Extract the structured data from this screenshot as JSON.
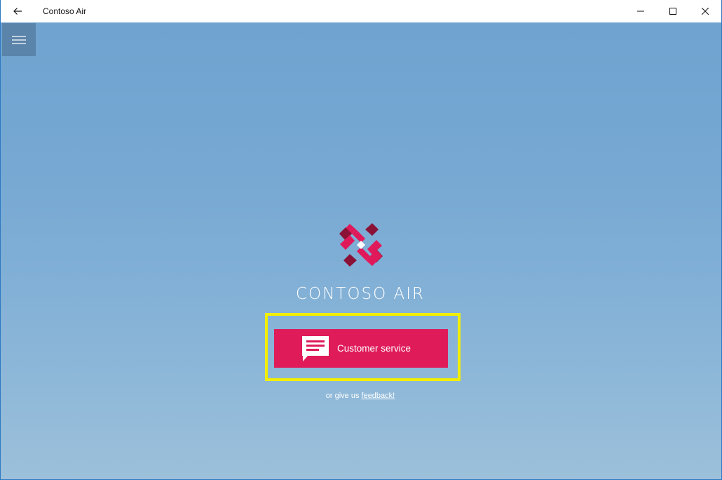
{
  "window": {
    "title": "Contoso Air"
  },
  "main": {
    "brand_name": "CONTOSO AIR",
    "customer_service_label": "Customer service",
    "feedback_prefix": "or give us ",
    "feedback_link": "feedback!"
  },
  "icons": {
    "back": "back-arrow-icon",
    "minimize": "minimize-icon",
    "maximize": "maximize-icon",
    "close": "close-icon",
    "menu": "hamburger-menu-icon",
    "logo": "contoso-air-logo",
    "chat": "chat-bubble-icon"
  },
  "colors": {
    "accent": "#df1b5a",
    "highlight": "#f2ee00",
    "background": "#76a8d3"
  }
}
